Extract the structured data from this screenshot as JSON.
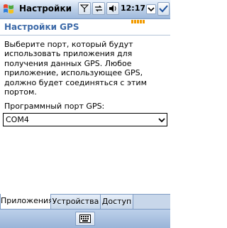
{
  "titlebar": {
    "title": "Настройки",
    "time": "12:17"
  },
  "page": {
    "title": "Настройки GPS",
    "description": "Выберите порт, который будут использовать приложения для получения данных GPS. Любое приложение, использующее GPS, должно будет соединяться с этим портом.",
    "port_label": "Программный порт GPS:",
    "port_value": "COM4"
  },
  "tabs": [
    {
      "label": "Приложения",
      "active": true
    },
    {
      "label": "Устройства",
      "active": false
    },
    {
      "label": "Доступ",
      "active": false
    }
  ],
  "icons": {
    "start": "windows-flag-icon",
    "signal": "signal-icon",
    "connectivity": "connectivity-icon",
    "volume": "volume-icon",
    "ok": "checkmark-icon",
    "keyboard": "keyboard-icon"
  },
  "colors": {
    "heading": "#3d6aa8",
    "battery": "#f29b00"
  }
}
